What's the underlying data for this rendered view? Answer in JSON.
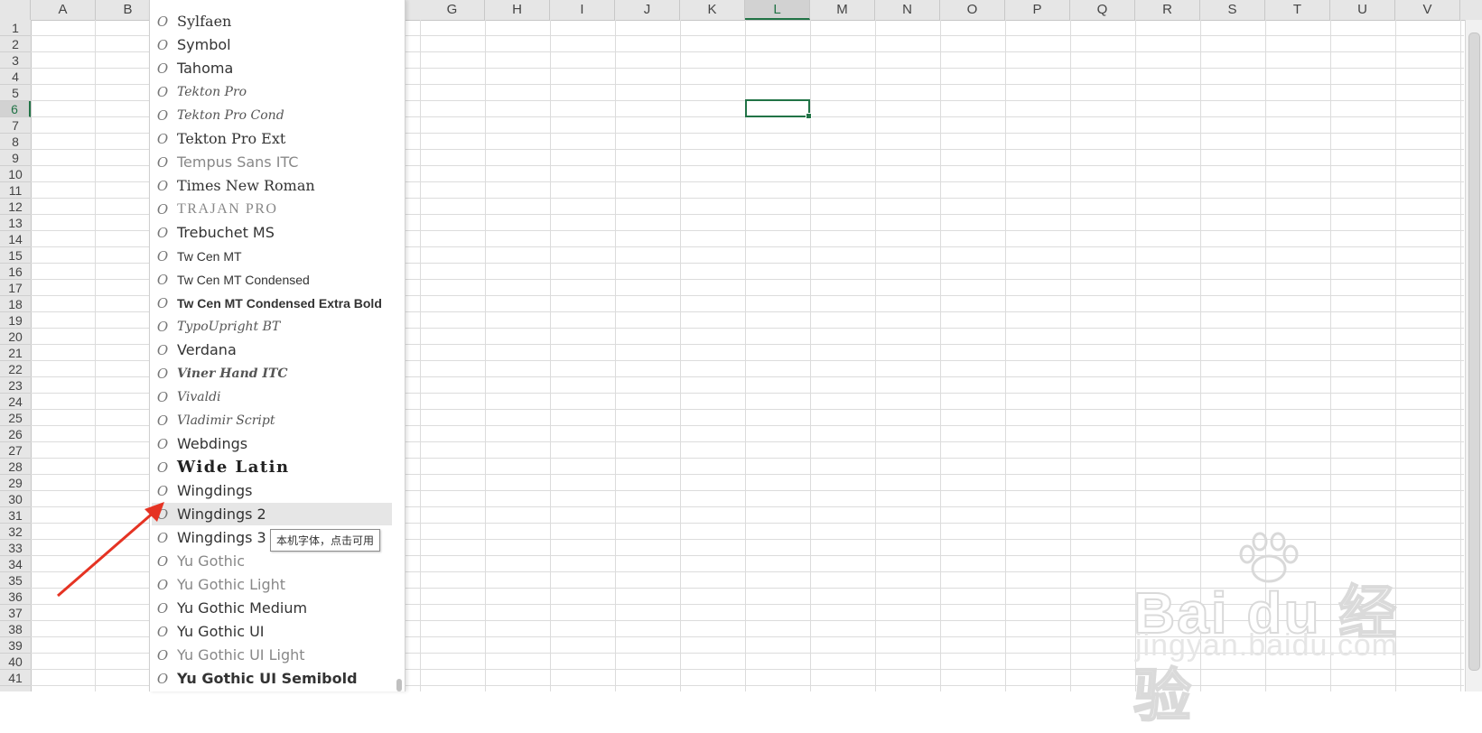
{
  "columns": {
    "left": [
      {
        "label": "A"
      },
      {
        "label": "B"
      }
    ],
    "right": [
      {
        "label": "G"
      },
      {
        "label": "H"
      },
      {
        "label": "I"
      },
      {
        "label": "J"
      },
      {
        "label": "K"
      },
      {
        "label": "L"
      },
      {
        "label": "M"
      },
      {
        "label": "N"
      },
      {
        "label": "O"
      },
      {
        "label": "P"
      },
      {
        "label": "Q"
      },
      {
        "label": "R"
      },
      {
        "label": "S"
      },
      {
        "label": "T"
      },
      {
        "label": "U"
      },
      {
        "label": "V"
      }
    ],
    "active": "L"
  },
  "rows": [
    "1",
    "2",
    "3",
    "4",
    "5",
    "6",
    "7",
    "8",
    "9",
    "10",
    "11",
    "12",
    "13",
    "14",
    "15",
    "16",
    "17",
    "18",
    "19",
    "20",
    "21",
    "22",
    "23",
    "24",
    "25",
    "26",
    "27",
    "28",
    "29",
    "30",
    "31",
    "32",
    "33",
    "34",
    "35",
    "36",
    "37",
    "38",
    "39",
    "40",
    "41"
  ],
  "active_row": "6",
  "font_list": {
    "items": [
      {
        "name": "Sylfaen",
        "style": "serif"
      },
      {
        "name": "Symbol",
        "style": ""
      },
      {
        "name": "Tahoma",
        "style": ""
      },
      {
        "name": "Tekton Pro",
        "style": "script"
      },
      {
        "name": "Tekton Pro Cond",
        "style": "script"
      },
      {
        "name": "Tekton Pro Ext",
        "style": "serif"
      },
      {
        "name": "Tempus Sans ITC",
        "style": "light"
      },
      {
        "name": "Times New Roman",
        "style": "serif"
      },
      {
        "name": "TRAJAN PRO",
        "style": "caps"
      },
      {
        "name": "Trebuchet MS",
        "style": ""
      },
      {
        "name": "Tw Cen MT",
        "style": "narrow"
      },
      {
        "name": "Tw Cen MT Condensed",
        "style": "narrow"
      },
      {
        "name": "Tw Cen MT Condensed Extra Bold",
        "style": "narrow bold"
      },
      {
        "name": "TypoUpright BT",
        "style": "script"
      },
      {
        "name": "Verdana",
        "style": ""
      },
      {
        "name": "Viner Hand ITC",
        "style": "script bold"
      },
      {
        "name": "Vivaldi",
        "style": "script"
      },
      {
        "name": "Vladimir Script",
        "style": "script"
      },
      {
        "name": "Webdings",
        "style": ""
      },
      {
        "name": "Wide Latin",
        "style": "wide"
      },
      {
        "name": "Wingdings",
        "style": ""
      },
      {
        "name": "Wingdings 2",
        "style": "highlighted"
      },
      {
        "name": "Wingdings 3",
        "style": ""
      },
      {
        "name": "Yu Gothic",
        "style": "light"
      },
      {
        "name": "Yu Gothic Light",
        "style": "light"
      },
      {
        "name": "Yu Gothic Medium",
        "style": ""
      },
      {
        "name": "Yu Gothic UI",
        "style": ""
      },
      {
        "name": "Yu Gothic UI Light",
        "style": "light"
      },
      {
        "name": "Yu Gothic UI Semibold",
        "style": "bold"
      }
    ],
    "highlighted_item": "Wingdings 2",
    "icon_glyph": "O"
  },
  "tooltip": {
    "text": "本机字体，点击可用"
  },
  "watermark": {
    "brand": "Bai du 经验",
    "url": "jingyan.baidu.com"
  },
  "colors": {
    "accent": "#217346",
    "arrow": "#e53323"
  }
}
